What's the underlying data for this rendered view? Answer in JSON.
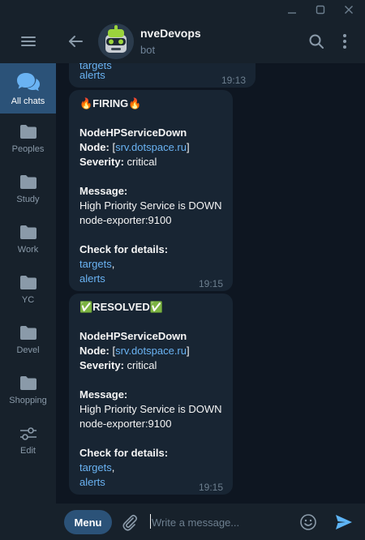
{
  "sidebar": {
    "folders": [
      {
        "label": "All chats",
        "icon": "chat-bubbles-icon"
      },
      {
        "label": "Peoples",
        "icon": "folder-icon"
      },
      {
        "label": "Study",
        "icon": "folder-icon"
      },
      {
        "label": "Work",
        "icon": "folder-icon"
      },
      {
        "label": "YC",
        "icon": "folder-icon"
      },
      {
        "label": "Devel",
        "icon": "folder-icon"
      },
      {
        "label": "Shopping",
        "icon": "folder-icon"
      },
      {
        "label": "Edit",
        "icon": "sliders-icon"
      }
    ]
  },
  "header": {
    "title": "nveDevops",
    "subtitle": "bot"
  },
  "messages": [
    {
      "partial": true,
      "links": [
        "targets",
        "alerts"
      ],
      "time": "19:13"
    },
    {
      "status": "🔥FIRING🔥",
      "alertname": "NodeHPServiceDown",
      "node_label": "Node:",
      "node_open": " [",
      "node_value": "srv.dotspace.ru",
      "node_close": "]",
      "severity_label": "Severity:",
      "severity_value": " critical",
      "message_label": "Message:",
      "message_line1": "High Priority Service is DOWN",
      "message_line2": "node-exporter:9100",
      "details_label": "Check for details:",
      "link1": "targets",
      "comma": ",",
      "link2": "alerts",
      "time": "19:15"
    },
    {
      "status": "✅RESOLVED✅",
      "alertname": "NodeHPServiceDown",
      "node_label": "Node:",
      "node_open": " [",
      "node_value": "srv.dotspace.ru",
      "node_close": "]",
      "severity_label": "Severity:",
      "severity_value": " critical",
      "message_label": "Message:",
      "message_line1": "High Priority Service is DOWN",
      "message_line2": "node-exporter:9100",
      "details_label": "Check for details:",
      "link1": "targets",
      "comma": ",",
      "link2": "alerts",
      "time": "19:15"
    }
  ],
  "composer": {
    "menu_label": "Menu",
    "placeholder": "Write a message..."
  },
  "colors": {
    "background": "#0e1621",
    "panel": "#17212b",
    "bubble": "#182533",
    "accent": "#2b5278",
    "link": "#6ab3f3",
    "send": "#5eb5f7"
  }
}
